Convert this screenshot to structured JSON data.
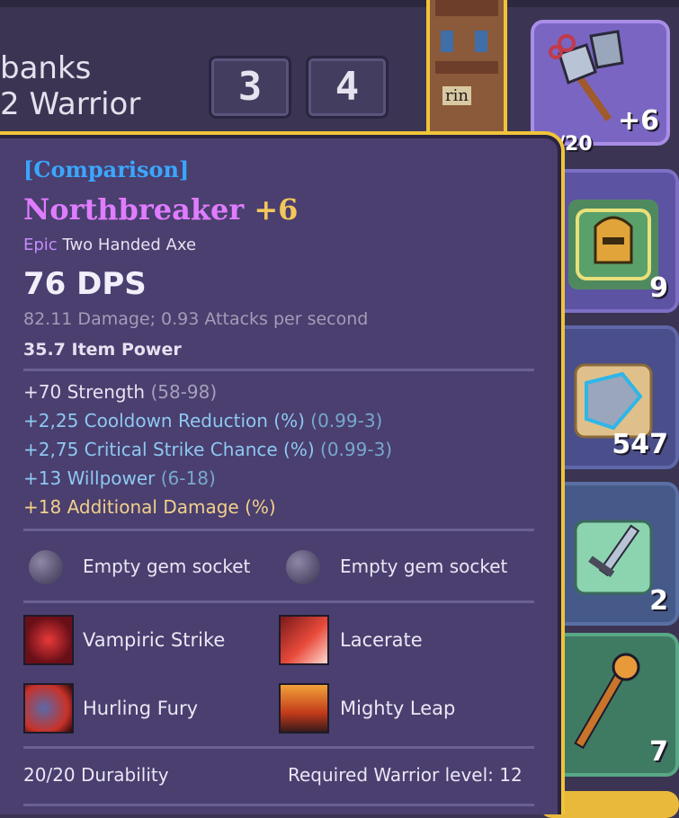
{
  "character": {
    "name_partial": "banks",
    "class_partial": "2 Warrior",
    "level_digits": [
      "3",
      "4"
    ]
  },
  "background_sign": "rin",
  "inventory": {
    "slot1_counter": "/20",
    "slot1_plus": "+6",
    "slot2_count": "9",
    "slot3_count": "547",
    "slot4_count": "2",
    "slot5_count": "7"
  },
  "tooltip": {
    "comparison": "[Comparison]",
    "item_name": "Northbreaker",
    "item_plus": "+6",
    "rarity": "Epic",
    "item_type": "Two Handed Axe",
    "dps": "76 DPS",
    "damage_line": "82.11 Damage; 0.93 Attacks per second",
    "item_power": "35.7 Item Power",
    "stats": [
      {
        "value": "+70 Strength",
        "range": "(58-98)"
      },
      {
        "value": "+2,25 Cooldown Reduction (%)",
        "range": "(0.99-3)"
      },
      {
        "value": "+2,75 Critical Strike Chance (%)",
        "range": "(0.99-3)"
      },
      {
        "value": "+13 Willpower",
        "range": "(6-18)"
      },
      {
        "value": "+18 Additional Damage (%)",
        "range": ""
      }
    ],
    "sockets": [
      "Empty gem socket",
      "Empty gem socket"
    ],
    "skills": [
      "Vampiric Strike",
      "Lacerate",
      "Hurling Fury",
      "Mighty Leap"
    ],
    "durability": "20/20 Durability",
    "required_level": "Required Warrior level: 12"
  },
  "colors": {
    "comparison": "#3aa7ff",
    "epic": "#e07cff",
    "border_gold": "#f0c43a",
    "bonus_gold": "#f2d08a",
    "stat_blue": "#8ec8f2"
  },
  "icons": {
    "slot1": "battle-axe-icon",
    "slot2": "helmet-scroll-icon",
    "slot3": "gauntlet-scroll-icon",
    "slot4": "sword-scroll-icon",
    "slot5": "staff-icon",
    "skill1": "vampiric-strike-icon",
    "skill2": "lacerate-icon",
    "skill3": "hurling-fury-icon",
    "skill4": "mighty-leap-icon"
  }
}
